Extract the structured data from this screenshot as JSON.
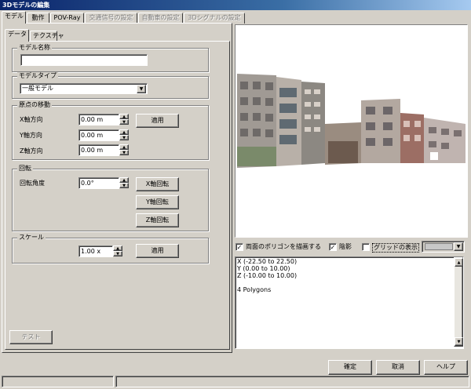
{
  "window": {
    "title": "3Dモデルの編集"
  },
  "main_tabs": [
    {
      "label": "モデル",
      "active": true,
      "enabled": true
    },
    {
      "label": "動作",
      "active": false,
      "enabled": true
    },
    {
      "label": "POV-Ray",
      "active": false,
      "enabled": true
    },
    {
      "label": "交通信号の設定",
      "active": false,
      "enabled": false
    },
    {
      "label": "自動車の設定",
      "active": false,
      "enabled": false
    },
    {
      "label": "3Dシグナルの設定",
      "active": false,
      "enabled": false
    }
  ],
  "sub_tabs": [
    {
      "label": "データ",
      "active": true
    },
    {
      "label": "テクスチャ",
      "active": false
    }
  ],
  "model_name": {
    "title": "モデル名称",
    "value": ""
  },
  "model_type": {
    "title": "モデルタイプ",
    "value": "一般モデル"
  },
  "origin": {
    "title": "原点の移動",
    "x_label": "X軸方向",
    "x_value": "0.00 m",
    "y_label": "Y軸方向",
    "y_value": "0.00 m",
    "z_label": "Z軸方向",
    "z_value": "0.00 m",
    "apply_label": "適用"
  },
  "rotation": {
    "title": "回転",
    "angle_label": "回転角度",
    "angle_value": "0.0°",
    "x_button": "X軸回転",
    "y_button": "Y軸回転",
    "z_button": "Z軸回転"
  },
  "scale": {
    "title": "スケール",
    "value": "1.00 x",
    "apply_label": "適用"
  },
  "test_button": "テスト",
  "view_options": {
    "double_sided": {
      "label": "両面のポリゴンを描画する",
      "checked": true
    },
    "lighting": {
      "label": "陰影",
      "checked": true
    },
    "grid": {
      "label": "グリッドの表示",
      "checked": false
    }
  },
  "info_lines": [
    "X (-22.50 to 22.50)",
    "Y (0.00 to 10.00)",
    "Z (-10.00 to 10.00)",
    "",
    "4 Polygons"
  ],
  "footer": {
    "ok": "確定",
    "cancel": "取消",
    "help": "ヘルプ"
  }
}
